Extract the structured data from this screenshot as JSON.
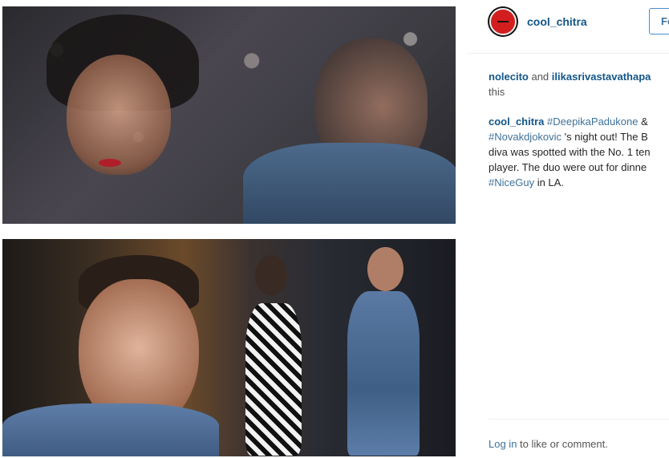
{
  "post": {
    "author": "cool_chitra",
    "follow_label": "Fo",
    "likes": {
      "user1": "nolecito",
      "and": "and",
      "user2": "ilikasrivastavathapa",
      "suffix": "this"
    },
    "caption": {
      "user": "cool_chitra",
      "line1_tag": "#DeepikaPadukone",
      "line1_rest": " &",
      "line2_tag": "#Novakdjokovic",
      "line2_rest": " 's night out! The B",
      "line3": "diva was spotted with the No. 1 ten",
      "line4": "player. The duo were out for dinne",
      "line5_tag": "#NiceGuy",
      "line5_rest": " in LA."
    },
    "login": {
      "link": "Log in",
      "rest": " to like or comment."
    }
  },
  "colors": {
    "link": "#125688",
    "hashtag": "#3f729b",
    "avatar_red": "#d21e1e"
  },
  "icons": {
    "avatar": "profile-avatar-icon"
  }
}
